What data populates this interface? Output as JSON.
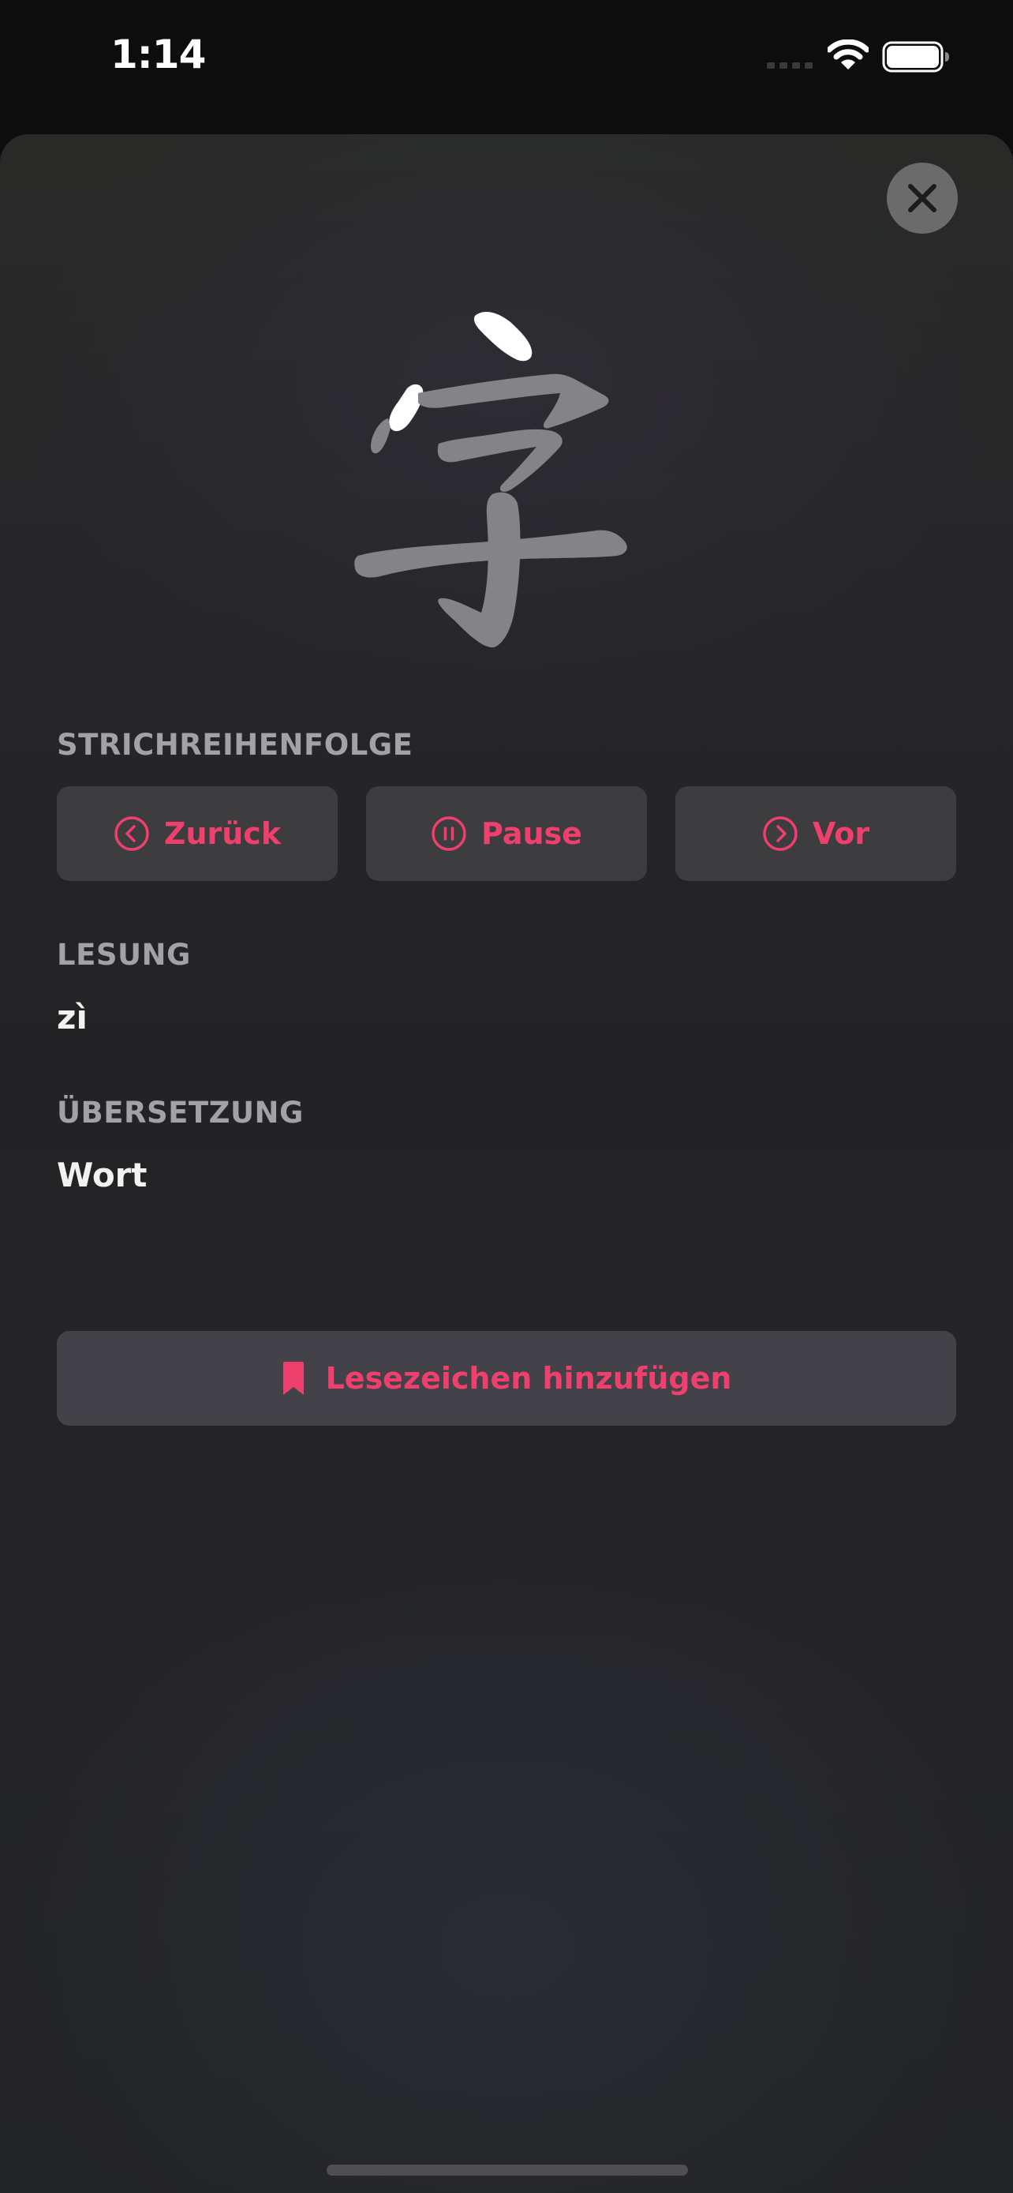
{
  "status_bar": {
    "time": "1:14"
  },
  "header": {
    "close_icon": "close-icon"
  },
  "character": {
    "glyph": "字",
    "highlighted_strokes": 2,
    "total_strokes": 6
  },
  "stroke_order": {
    "label": "STRICHREIHENFOLGE",
    "buttons": [
      {
        "label": "Zurück",
        "icon": "chevron-left-circle-icon"
      },
      {
        "label": "Pause",
        "icon": "pause-circle-icon"
      },
      {
        "label": "Vor",
        "icon": "chevron-right-circle-icon"
      }
    ]
  },
  "reading": {
    "label": "LESUNG",
    "value": "zì"
  },
  "translation": {
    "label": "ÜBERSETZUNG",
    "value": "Wort"
  },
  "bookmark": {
    "label": "Lesezeichen hinzufügen",
    "icon": "bookmark-icon"
  },
  "colors": {
    "accent": "#ee3f6d",
    "sheet_background": "#262528",
    "button_background": "#3d3d3f",
    "stroke_active": "#ffffff",
    "stroke_pending": "#848488"
  }
}
